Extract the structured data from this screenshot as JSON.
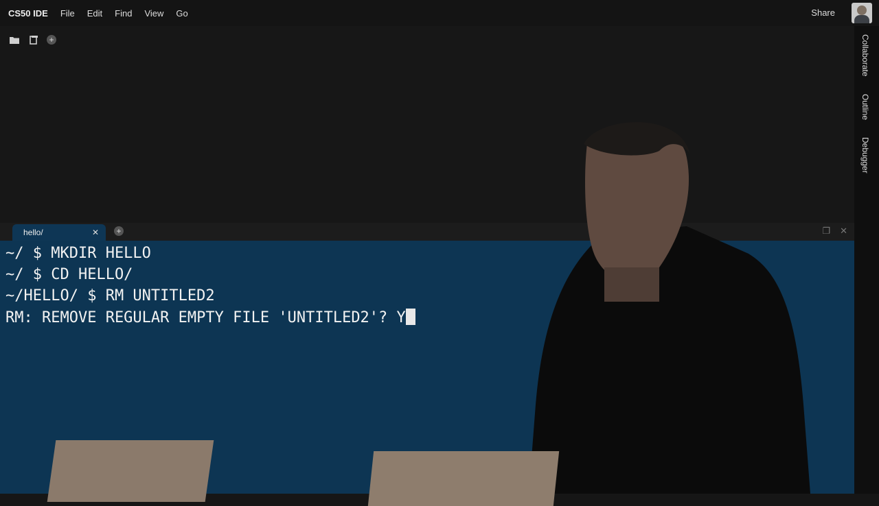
{
  "menubar": {
    "brand": "CS50 IDE",
    "items": [
      "File",
      "Edit",
      "Find",
      "View",
      "Go"
    ],
    "share": "Share"
  },
  "sidebar_right": {
    "items": [
      "Collaborate",
      "Outline",
      "Debugger"
    ]
  },
  "terminal": {
    "tab_label": "hello/",
    "lines": [
      "~/ $ MKDIR HELLO",
      "~/ $ CD HELLO/",
      "~/HELLO/ $ RM UNTITLED2",
      "RM: REMOVE REGULAR EMPTY FILE 'UNTITLED2'? Y"
    ]
  },
  "icons": {
    "folder": "folder-icon",
    "file": "file-icon",
    "add": "plus-icon",
    "close": "close-icon",
    "maximize": "maximize-icon"
  }
}
